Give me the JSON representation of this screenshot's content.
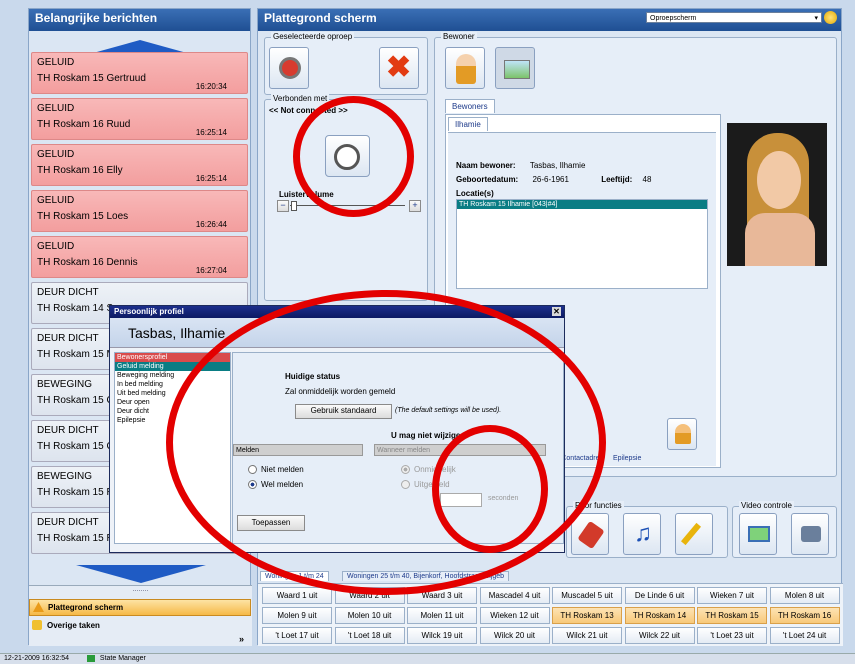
{
  "left": {
    "title": "Belangrijke berichten",
    "messages": [
      {
        "type": "GELUID",
        "loc": "TH Roskam 15 Gertruud",
        "time": "16:20:34",
        "state": "red"
      },
      {
        "type": "GELUID",
        "loc": "TH Roskam 16 Ruud",
        "time": "16:25:14",
        "state": "red"
      },
      {
        "type": "GELUID",
        "loc": "TH Roskam 16 Elly",
        "time": "16:25:14",
        "state": "red"
      },
      {
        "type": "GELUID",
        "loc": "TH Roskam 15 Loes",
        "time": "16:26:44",
        "state": "red"
      },
      {
        "type": "GELUID",
        "loc": "TH Roskam 16 Dennis",
        "time": "16:27:04",
        "state": "red"
      },
      {
        "type": "DEUR DICHT",
        "loc": "TH Roskam 14 S",
        "time": "",
        "state": "gray"
      },
      {
        "type": "DEUR DICHT",
        "loc": "TH Roskam 15 M",
        "time": "",
        "state": "gray"
      },
      {
        "type": "BEWEGING",
        "loc": "TH Roskam 15 C",
        "time": "",
        "state": "gray"
      },
      {
        "type": "DEUR DICHT",
        "loc": "TH Roskam 15 C",
        "time": "",
        "state": "gray"
      },
      {
        "type": "BEWEGING",
        "loc": "TH Roskam 15 R",
        "time": "",
        "state": "gray"
      },
      {
        "type": "DEUR DICHT",
        "loc": "TH Roskam 15 R",
        "time": "",
        "state": "gray"
      }
    ],
    "dots": "........",
    "nav": [
      {
        "label": "Plattegrond scherm",
        "active": true
      },
      {
        "label": "Overige taken",
        "active": false
      }
    ]
  },
  "main": {
    "title": "Plattegrond scherm",
    "dropdown": "Oproepscherm",
    "geselecteerde_oproep": "Geselecteerde oproep",
    "verbonden_met": "Verbonden met",
    "not_connected": "<< Not connected >>",
    "luister_volume": "Luistervolume",
    "bewoner": "Bewoner",
    "tab_bewoners": "Bewoners",
    "tab_ilhamie": "Ilhamie",
    "naam_label": "Naam bewoner:",
    "naam_value": "Tasbas, Ilhamie",
    "geb_label": "Geboortedatum:",
    "geb_value": "26-6-1961",
    "leeftijd_label": "Leeftijd:",
    "leeftijd_value": "48",
    "locatie_label": "Locatie(s)",
    "locatie_value": "TH Roskam 15 Ilhamie [043|#4]",
    "bottom_tabs": [
      "ch",
      "Contactadres",
      "Epilepsie"
    ],
    "prior_functies": "Prior functies",
    "video_controle": "Video controle",
    "room_tabs": [
      "Woningen 1 t/m 24",
      "Woningen 25 t/m 40, Bijenkorf, Hoofdstraat, Bijgeb"
    ],
    "rooms": [
      [
        {
          "l": "Waard 1 uit"
        },
        {
          "l": "Waard 2 uit"
        },
        {
          "l": "Waard 3 uit"
        },
        {
          "l": "Mascadel 4 uit"
        },
        {
          "l": "Muscadel 5 uit"
        },
        {
          "l": "De Linde 6 uit"
        },
        {
          "l": "Wieken 7 uit"
        },
        {
          "l": "Molen 8 uit"
        }
      ],
      [
        {
          "l": "Molen 9 uit"
        },
        {
          "l": "Molen 10 uit"
        },
        {
          "l": "Molen 11 uit"
        },
        {
          "l": "Wieken 12 uit"
        },
        {
          "l": "TH Roskam 13 aan",
          "h": true
        },
        {
          "l": "TH Roskam 14 aan",
          "h": true
        },
        {
          "l": "TH Roskam 15 aan",
          "h": true
        },
        {
          "l": "TH Roskam 16 aan",
          "h": true
        }
      ],
      [
        {
          "l": "'t Loet 17 uit"
        },
        {
          "l": "'t Loet 18 uit"
        },
        {
          "l": "Wilck 19 uit"
        },
        {
          "l": "Wilck 20 uit"
        },
        {
          "l": "Wilck 21 uit"
        },
        {
          "l": "Wilck 22 uit"
        },
        {
          "l": "'t Loet 23 uit"
        },
        {
          "l": "'t Loet 24 uit"
        }
      ]
    ]
  },
  "dialog": {
    "title": "Persoonlijk profiel",
    "name": "Tasbas, Ilhamie",
    "list": [
      "Bewonersprofiel",
      "Geluid melding",
      "Beweging melding",
      "In bed melding",
      "Uit bed melding",
      "Deur open",
      "Deur dicht",
      "Epilepsie"
    ],
    "huidige_status": "Huidige status",
    "zal_text": "Zal onmiddelijk worden gemeld",
    "gebruik_standaard": "Gebruik standaard",
    "default_note": "(The default settings will be used).",
    "mag_niet": "U mag niet wijzigen:",
    "melden_header": "Melden",
    "wanneer_header": "Wanneer melden",
    "niet_melden": "Niet melden",
    "wel_melden": "Wel melden",
    "direct": "Onmiddelijk",
    "uitgesteld": "Uitgesteld",
    "seconden": "seconden",
    "toepassen": "Toepassen"
  },
  "status": {
    "datetime": "12-21-2009 16:32:54",
    "state_manager": "State Manager"
  }
}
